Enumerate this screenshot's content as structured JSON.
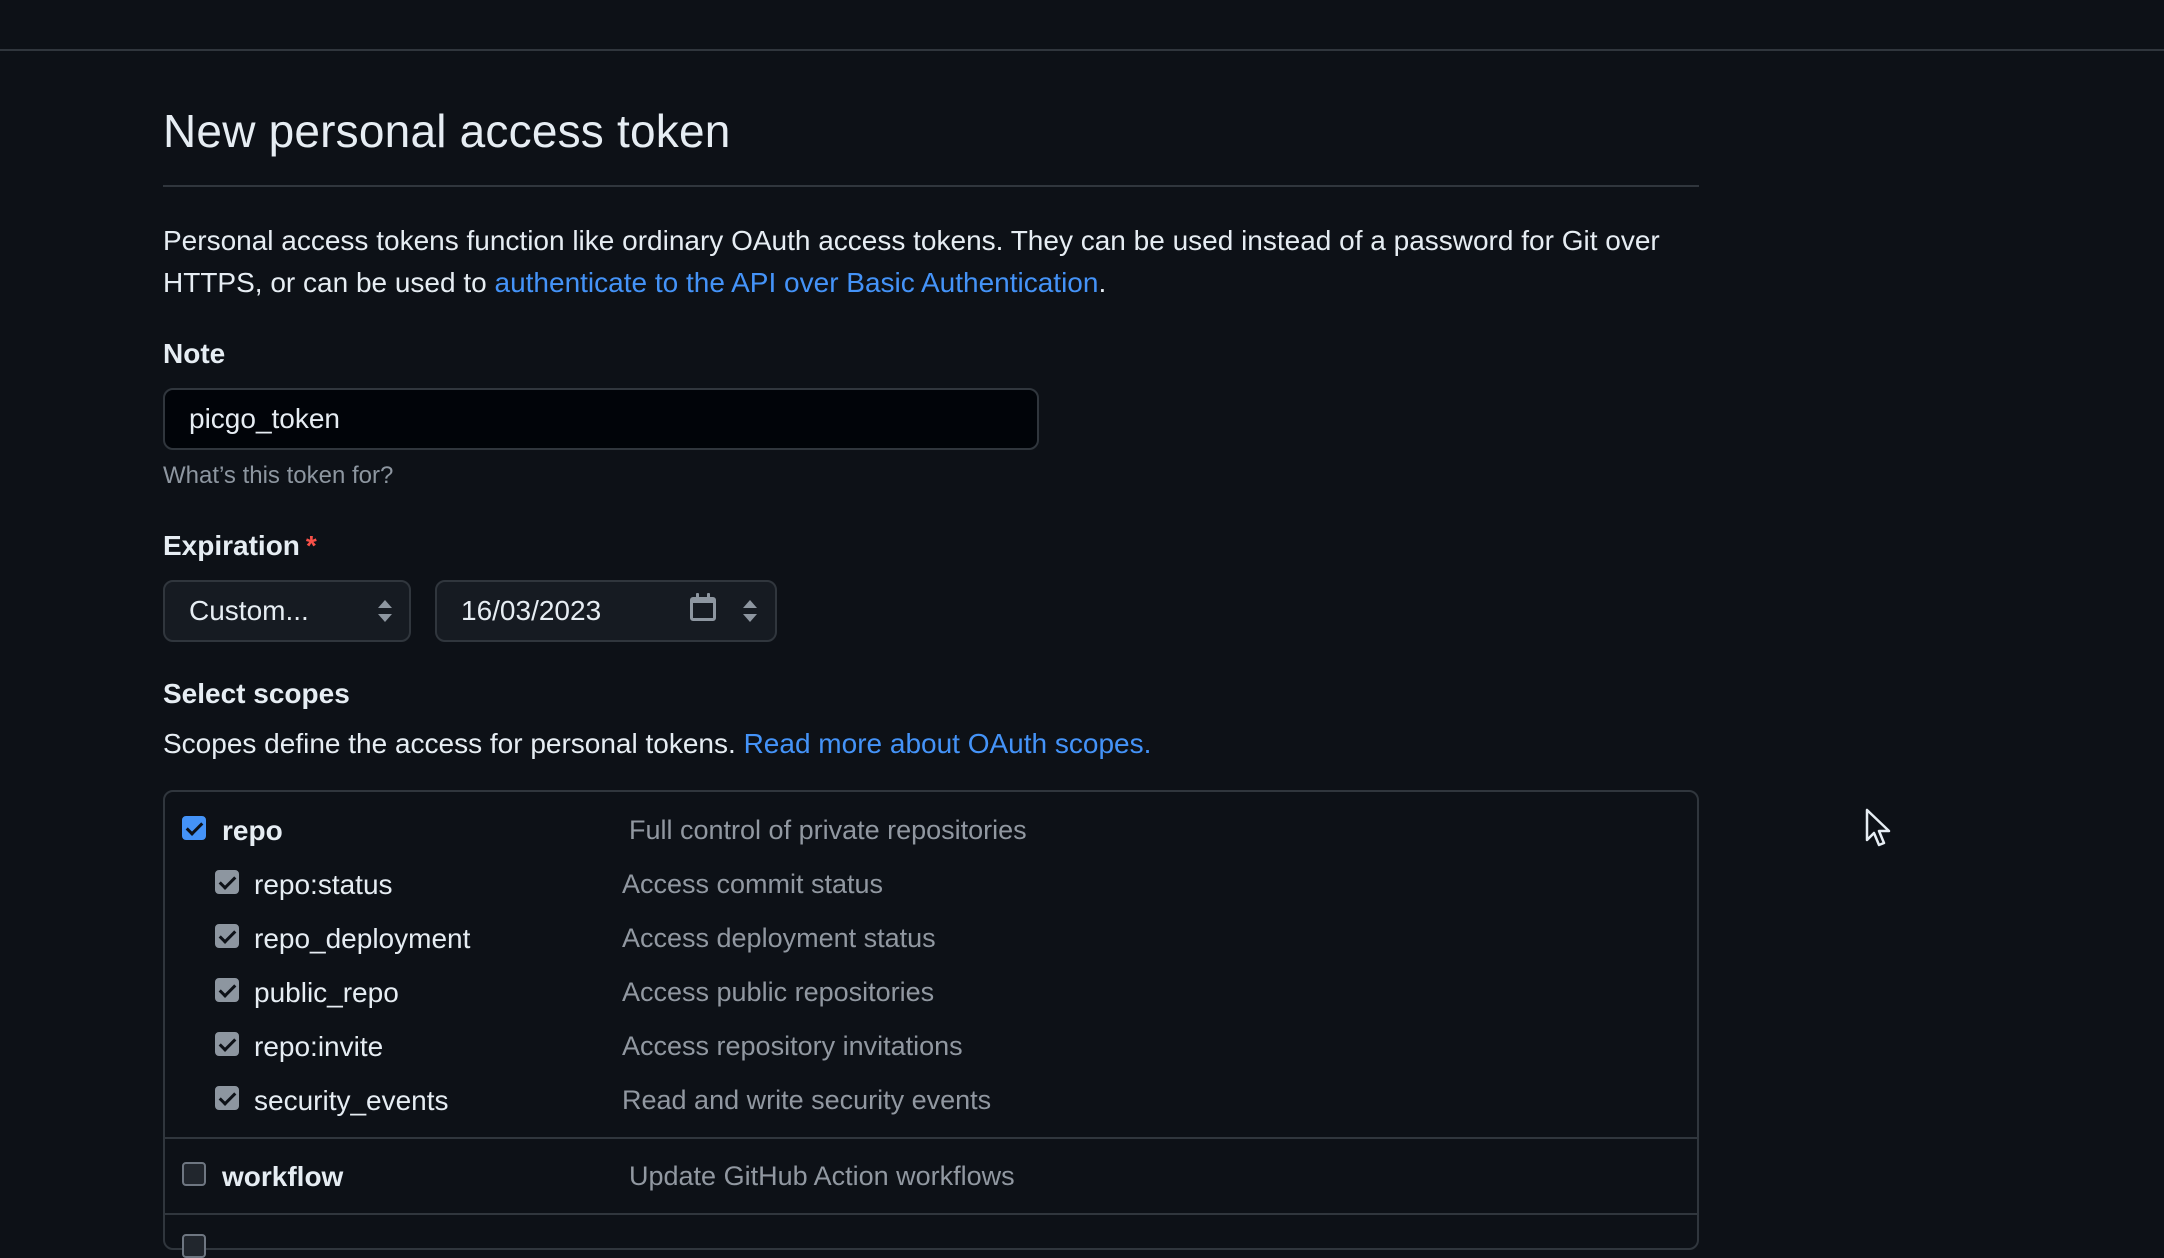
{
  "page": {
    "title": "New personal access token",
    "description_before_link": "Personal access tokens function like ordinary OAuth access tokens. They can be used instead of a password for Git over HTTPS, or can be used to ",
    "description_link": "authenticate to the API over Basic Authentication",
    "description_after_link": "."
  },
  "note": {
    "label": "Note",
    "value": "picgo_token",
    "hint": "What’s this token for?"
  },
  "expiration": {
    "label": "Expiration",
    "required_mark": "*",
    "select_value": "Custom...",
    "date_value": "16/03/2023"
  },
  "scopes": {
    "heading": "Select scopes",
    "description": "Scopes define the access for personal tokens.",
    "description_link": "Read more about OAuth scopes.",
    "groups": [
      {
        "name": "repo",
        "description": "Full control of private repositories",
        "checked": true,
        "children": [
          {
            "name": "repo:status",
            "description": "Access commit status",
            "checked": true
          },
          {
            "name": "repo_deployment",
            "description": "Access deployment status",
            "checked": true
          },
          {
            "name": "public_repo",
            "description": "Access public repositories",
            "checked": true
          },
          {
            "name": "repo:invite",
            "description": "Access repository invitations",
            "checked": true
          },
          {
            "name": "security_events",
            "description": "Read and write security events",
            "checked": true
          }
        ]
      },
      {
        "name": "workflow",
        "description": "Update GitHub Action workflows",
        "checked": false,
        "children": []
      }
    ]
  },
  "colors": {
    "background": "#0d1117",
    "border": "#30363d",
    "text": "#e6edf3",
    "muted": "#8d96a0",
    "link": "#4493f8",
    "required": "#f85149"
  }
}
